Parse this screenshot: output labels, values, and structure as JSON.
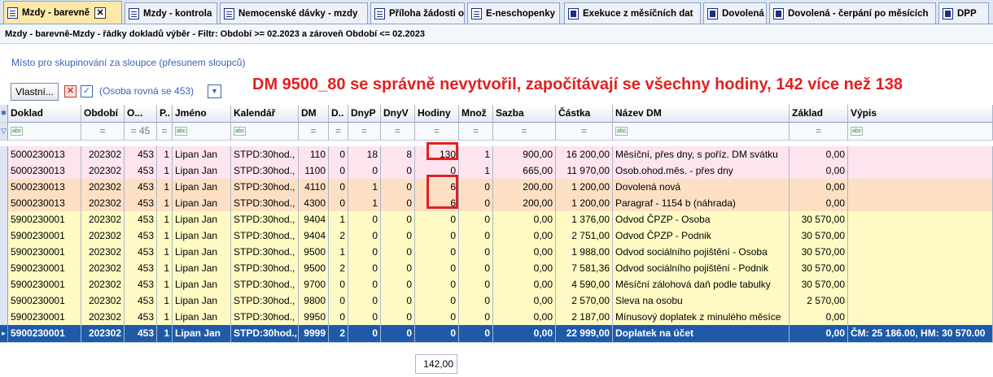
{
  "tabs": [
    {
      "label": "Mzdy - barevně",
      "icon": "doc",
      "active": true
    },
    {
      "label": "Mzdy - kontrola",
      "icon": "doc"
    },
    {
      "label": "Nemocenské dávky - mzdy",
      "icon": "doc"
    },
    {
      "label": "Příloha žádosti o",
      "icon": "doc"
    },
    {
      "label": "E-neschopenky",
      "icon": "doc"
    },
    {
      "label": "Exekuce z měsíčních dat",
      "icon": "win"
    },
    {
      "label": "Dovolená",
      "icon": "win"
    },
    {
      "label": "Dovolená - čerpání po měsících",
      "icon": "win"
    },
    {
      "label": "DPP",
      "icon": "win"
    }
  ],
  "filterbar": {
    "text": "Mzdy - barevně-Mzdy - řádky dokladů výběr  -  Filtr: Období >= 02.2023  a zároveň  Období <= 02.2023"
  },
  "grouping_hint": "Místo pro skupinování za sloupce (přesunem sloupců)",
  "toolbar": {
    "vlastni_label": "Vlastní...",
    "filter_text": "(Osoba rovná se 453)"
  },
  "note": "DM 9500_80 se správně nevytvořil, započítávají se všechny hodiny, 142 více než 138",
  "columns": [
    "Doklad",
    "Období",
    "O...",
    "P..",
    "Jméno",
    "Kalendář",
    "DM",
    "D..",
    "DnyP",
    "DnyV",
    "Hodiny",
    "Množ",
    "Sazba",
    "Částka",
    "Název DM",
    "Základ",
    "Výpis"
  ],
  "filter_row": [
    "abc",
    "=",
    "= 45",
    "=",
    "abc",
    "abc",
    "=",
    "=",
    "=",
    "=",
    "=",
    "=",
    "=",
    "=",
    "abc",
    "=",
    "abc"
  ],
  "rows": [
    {
      "style": "pink",
      "cells": [
        "5000230013",
        "202302",
        "453",
        "1",
        "Lipan Jan",
        "STPD:30hod.,",
        "110",
        "0",
        "18",
        "8",
        "130",
        "1",
        "900,00",
        "16 200,00",
        "Měsíční, přes dny, s poříz. DM svátku",
        "0,00",
        ""
      ]
    },
    {
      "style": "pink",
      "cells": [
        "5000230013",
        "202302",
        "453",
        "1",
        "Lipan Jan",
        "STPD:30hod.,",
        "1100",
        "0",
        "0",
        "0",
        "0",
        "1",
        "665,00",
        "11 970,00",
        "Osob.ohod.měs. - přes dny",
        "0,00",
        ""
      ]
    },
    {
      "style": "orange",
      "cells": [
        "5000230013",
        "202302",
        "453",
        "1",
        "Lipan Jan",
        "STPD:30hod.,",
        "4110",
        "0",
        "1",
        "0",
        "6",
        "0",
        "200,00",
        "1 200,00",
        "Dovolená nová",
        "0,00",
        ""
      ]
    },
    {
      "style": "orange",
      "cells": [
        "5000230013",
        "202302",
        "453",
        "1",
        "Lipan Jan",
        "STPD:30hod.,",
        "4300",
        "0",
        "1",
        "0",
        "6",
        "0",
        "200,00",
        "1 200,00",
        "Paragraf - 1154 b (náhrada)",
        "0,00",
        ""
      ]
    },
    {
      "style": "yellow",
      "cells": [
        "5900230001",
        "202302",
        "453",
        "1",
        "Lipan Jan",
        "STPD:30hod.,",
        "9404",
        "1",
        "0",
        "0",
        "0",
        "0",
        "0,00",
        "1 376,00",
        "Odvod ČPZP - Osoba",
        "30 570,00",
        ""
      ]
    },
    {
      "style": "yellow",
      "cells": [
        "5900230001",
        "202302",
        "453",
        "1",
        "Lipan Jan",
        "STPD:30hod.,",
        "9404",
        "2",
        "0",
        "0",
        "0",
        "0",
        "0,00",
        "2 751,00",
        "Odvod ČPZP - Podnik",
        "30 570,00",
        ""
      ]
    },
    {
      "style": "yellow",
      "cells": [
        "5900230001",
        "202302",
        "453",
        "1",
        "Lipan Jan",
        "STPD:30hod.,",
        "9500",
        "1",
        "0",
        "0",
        "0",
        "0",
        "0,00",
        "1 988,00",
        "Odvod sociálního pojištění - Osoba",
        "30 570,00",
        ""
      ]
    },
    {
      "style": "yellow",
      "cells": [
        "5900230001",
        "202302",
        "453",
        "1",
        "Lipan Jan",
        "STPD:30hod.,",
        "9500",
        "2",
        "0",
        "0",
        "0",
        "0",
        "0,00",
        "7 581,36",
        "Odvod sociálního pojištění - Podnik",
        "30 570,00",
        ""
      ]
    },
    {
      "style": "yellow",
      "cells": [
        "5900230001",
        "202302",
        "453",
        "1",
        "Lipan Jan",
        "STPD:30hod.,",
        "9700",
        "0",
        "0",
        "0",
        "0",
        "0",
        "0,00",
        "4 590,00",
        "Měsíční zálohová daň podle tabulky",
        "30 570,00",
        ""
      ]
    },
    {
      "style": "yellow",
      "cells": [
        "5900230001",
        "202302",
        "453",
        "1",
        "Lipan Jan",
        "STPD:30hod.,",
        "9800",
        "0",
        "0",
        "0",
        "0",
        "0",
        "0,00",
        "2 570,00",
        "Sleva na osobu",
        "2 570,00",
        ""
      ]
    },
    {
      "style": "yellow",
      "cells": [
        "5900230001",
        "202302",
        "453",
        "1",
        "Lipan Jan",
        "STPD:30hod.,",
        "9950",
        "0",
        "0",
        "0",
        "0",
        "0",
        "0,00",
        "2 187,00",
        "Mínusový doplatek z minulého měsíce",
        "0,00",
        ""
      ]
    },
    {
      "style": "sel",
      "cells": [
        "5900230001",
        "202302",
        "453",
        "1",
        "Lipan Jan",
        "STPD:30hod.,",
        "9999",
        "2",
        "0",
        "0",
        "0",
        "0",
        "0,00",
        "22 999,00",
        "Doplatek na účet",
        "0,00",
        "ČM: 25 186.00, HM: 30 570.00"
      ]
    }
  ],
  "hours_sum": "142,00",
  "colors": {
    "accent": "#1e5aa8",
    "note": "#e32020",
    "pink": "#fde4ef",
    "orange": "#fde0c4",
    "yellow": "#fffac4"
  }
}
